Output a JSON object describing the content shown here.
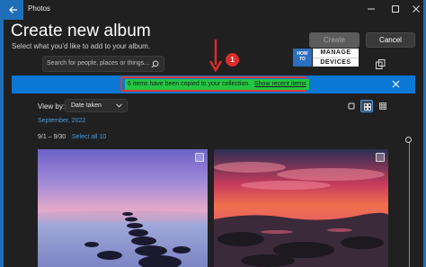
{
  "app": {
    "name": "Photos",
    "title": "Create new album",
    "subtitle": "Select what you'd like to add to your album."
  },
  "actions": {
    "create_label": "Create",
    "cancel_label": "Cancel"
  },
  "search": {
    "placeholder": "Search for people, places or things..."
  },
  "logo": {
    "how_to_lines": [
      "HOW",
      "TO"
    ],
    "manage": "MANAGE",
    "devices": "DEVICES"
  },
  "annotation": {
    "step_number": "1"
  },
  "banner": {
    "message": "6 items have been copied to your collection.",
    "link": "Show recent items"
  },
  "view": {
    "label": "View by:",
    "selected": "Date taken"
  },
  "gallery": {
    "month": "September, 2022",
    "date_range": "9/1 – 9/30",
    "select_all": "Select all 10"
  },
  "colors": {
    "accent": "#0a78d4",
    "highlight_green": "#22c742",
    "annotation_red": "#e02b2b"
  }
}
